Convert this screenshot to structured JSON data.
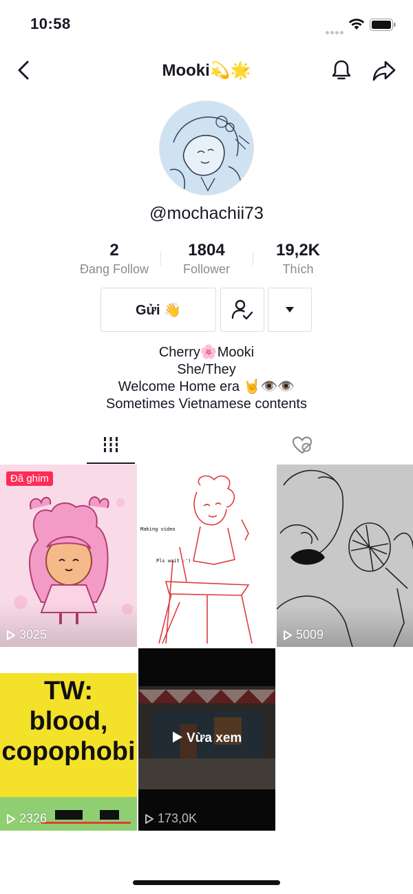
{
  "status": {
    "time": "10:58"
  },
  "header": {
    "title": "Mooki💫🌟"
  },
  "profile": {
    "handle": "@mochachii73",
    "stats": [
      {
        "count": "2",
        "label": "Đang Follow"
      },
      {
        "count": "1804",
        "label": "Follower"
      },
      {
        "count": "19,2K",
        "label": "Thích"
      }
    ],
    "send_label": "Gửi 👋",
    "bio": [
      "Cherry🌸Mooki",
      "She/They",
      "Welcome Home era 🤘👁️👁️",
      "Sometimes Vietnamese contents"
    ]
  },
  "videos": [
    {
      "views": "3025",
      "badge": "Đã ghim"
    },
    {
      "views": "",
      "overlay_lines": [
        "Making video",
        "Pls wait :')"
      ]
    },
    {
      "views": "5009"
    },
    {
      "views": "2326",
      "overlay_lines": [
        "TW:",
        "blood,",
        "copophobi"
      ]
    },
    {
      "views": "173,0K",
      "label": "Vừa xem"
    }
  ],
  "colors": {
    "accent": "#fe2c55",
    "text": "#161823",
    "muted": "#8a8b91"
  }
}
